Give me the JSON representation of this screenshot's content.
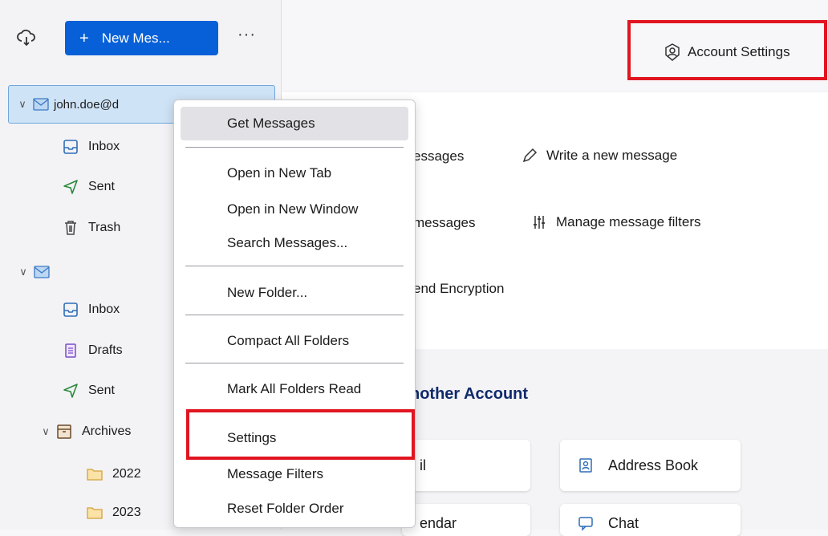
{
  "toolbar": {
    "new_message_label": "New Mes...",
    "new_message_icon": "+",
    "more_label": "···"
  },
  "folder_tree": {
    "account1": {
      "email": "john.doe@d",
      "folders": [
        {
          "label": "Inbox",
          "icon": "inbox-icon"
        },
        {
          "label": "Sent",
          "icon": "sent-icon"
        },
        {
          "label": "Trash",
          "icon": "trash-icon"
        }
      ]
    },
    "account2": {
      "folders": [
        {
          "label": "Inbox",
          "icon": "inbox-icon"
        },
        {
          "label": "Drafts",
          "icon": "drafts-icon"
        },
        {
          "label": "Sent",
          "icon": "sent-icon"
        },
        {
          "label": "Archives",
          "icon": "archive-icon"
        },
        {
          "label": "2022",
          "icon": "folder-icon"
        },
        {
          "label": "2023",
          "icon": "folder-icon"
        }
      ]
    }
  },
  "main": {
    "account_settings_label": "Account Settings",
    "actions": {
      "read_messages": "essages",
      "write_message": "Write a new message",
      "search_messages": "messages",
      "manage_filters": "Manage message filters",
      "encryption": "end Encryption"
    },
    "setup_section_title": "nother Account",
    "tiles": {
      "email": "il",
      "address_book": "Address Book",
      "calendar": "endar",
      "chat": "Chat"
    }
  },
  "context_menu": {
    "items": [
      "Get Messages",
      "Open in New Tab",
      "Open in New Window",
      "Search Messages...",
      "New Folder...",
      "Compact All Folders",
      "Mark All Folders Read",
      "Settings",
      "Message Filters",
      "Reset Folder Order"
    ]
  },
  "colors": {
    "accent": "#0860d8",
    "highlight": "#e11520",
    "selected_row": "#cfe3f6"
  }
}
